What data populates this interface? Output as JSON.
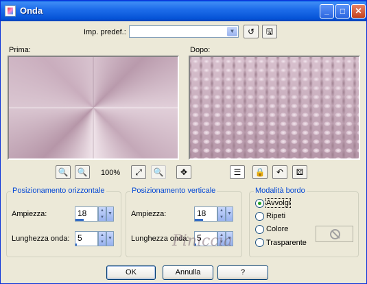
{
  "window": {
    "title": "Onda",
    "controls": [
      "_",
      "□",
      "✕"
    ]
  },
  "preset": {
    "label": "Imp. predef.:",
    "value": ""
  },
  "preview": {
    "before_label": "Prima:",
    "after_label": "Dopo:",
    "zoom": "100%"
  },
  "horizontal": {
    "title": "Posizionamento orizzontale",
    "amplitude_label": "Ampiezza:",
    "amplitude_value": "18",
    "wavelength_label": "Lunghezza onda:",
    "wavelength_value": "5"
  },
  "vertical": {
    "title": "Posizionamento verticale",
    "amplitude_label": "Ampiezza:",
    "amplitude_value": "18",
    "wavelength_label": "Lunghezza onda:",
    "wavelength_value": "5"
  },
  "edge_mode": {
    "title": "Modalità bordo",
    "options": [
      "Avvolgi",
      "Ripeti",
      "Colore",
      "Trasparente"
    ],
    "selected": "Avvolgi"
  },
  "watermark": "Piniccia",
  "buttons": {
    "ok": "OK",
    "cancel": "Annulla",
    "help": "?"
  }
}
